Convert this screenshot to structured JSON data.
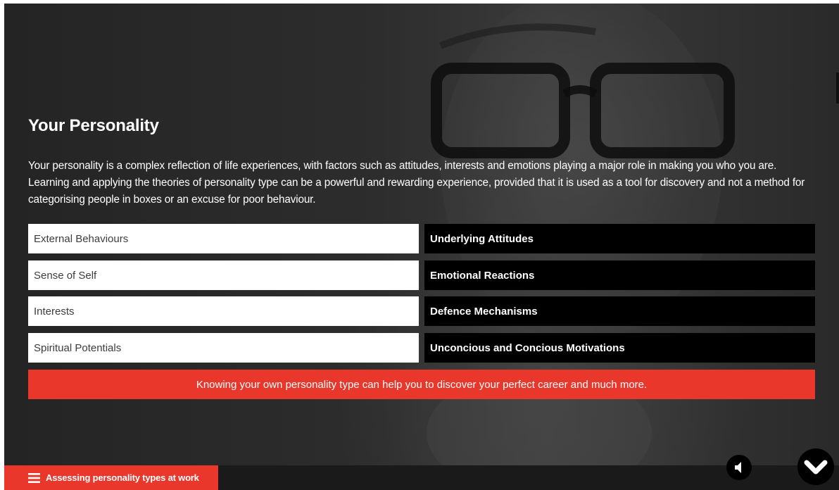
{
  "page": {
    "title": "Your Personality",
    "intro": "Your personality is a complex reflection of life experiences, with factors such as attitudes, interests and emotions playing a major role in making you who you are. Learning and applying the theories of personality type can be a powerful and rewarding experience, provided that it is used as a tool for discovery and not a method for categorising people in boxes or an excuse for poor behaviour."
  },
  "grid": {
    "left": [
      "External Behaviours",
      "Sense of Self",
      "Interests",
      "Spiritual Potentials"
    ],
    "right": [
      "Underlying Attitudes",
      "Emotional Reactions",
      "Defence Mechanisms",
      "Unconcious and Concious Motivations"
    ]
  },
  "banner": {
    "text": "Knowing your own personality type can help you to discover your perfect career and much more."
  },
  "footer": {
    "menu_label": "Assessing personality types at work",
    "menu_icon": "hamburger-icon",
    "audio_icon": "speaker-icon",
    "next_icon": "chevron-down-icon"
  },
  "colors": {
    "accent": "#e9372c",
    "dark_cell": "#000000",
    "light_cell": "#ffffff"
  }
}
